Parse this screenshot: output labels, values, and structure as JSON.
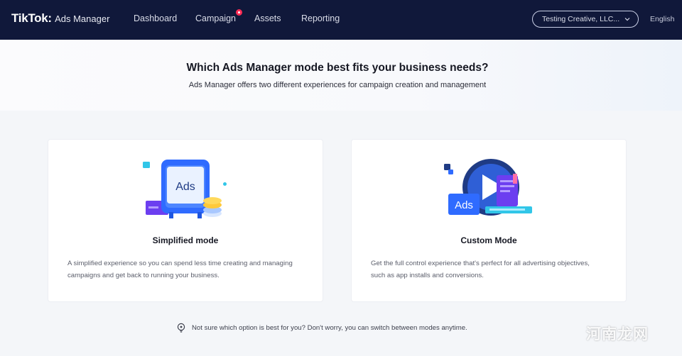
{
  "brand": {
    "logo": "TikTok",
    "colon": ":",
    "product": "Ads Manager"
  },
  "nav": {
    "items": [
      {
        "label": "Dashboard"
      },
      {
        "label": "Campaign",
        "has_notification": true
      },
      {
        "label": "Assets"
      },
      {
        "label": "Reporting"
      }
    ]
  },
  "account": {
    "selected": "Testing Creative, LLC...",
    "icon": "chevron-down-icon"
  },
  "language": "English",
  "hero": {
    "title": "Which Ads Manager mode best fits your business needs?",
    "subtitle": "Ads Manager offers two different experiences for campaign creation and management"
  },
  "modes": [
    {
      "title": "Simplified mode",
      "description": "A simplified experience so you can spend less time creating and managing campaigns and get back to running your business.",
      "illustration_label": "Ads"
    },
    {
      "title": "Custom Mode",
      "description": "Get the full control experience that's perfect for all advertising objectives, such as app installs and conversions.",
      "illustration_label": "Ads"
    }
  ],
  "footer_note": "Not sure which option is best for you? Don't worry, you can switch between modes anytime.",
  "watermark": "河南龙网",
  "colors": {
    "topbar": "#10183a",
    "accent_blue": "#2f6bff",
    "purple": "#6c3ef0",
    "cyan": "#31c6e8",
    "notification": "#fe2c55"
  }
}
